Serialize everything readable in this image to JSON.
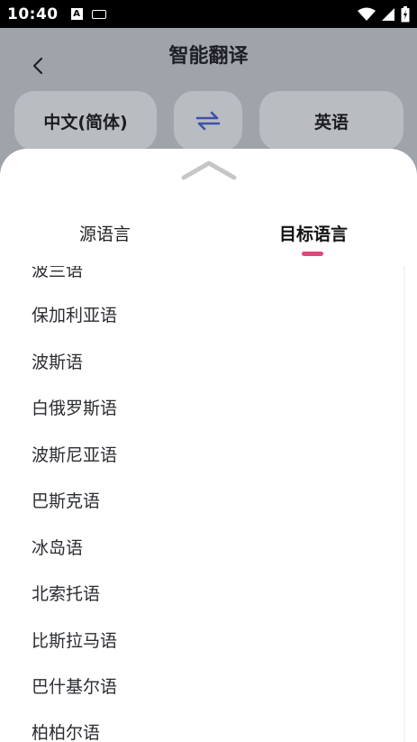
{
  "status": {
    "time": "10:40",
    "a_icon": "A"
  },
  "header": {
    "title": "智能翻译"
  },
  "languages": {
    "source": "中文(简体)",
    "target": "英语"
  },
  "sheet": {
    "tabs": [
      {
        "label": "源语言"
      },
      {
        "label": "目标语言"
      }
    ],
    "items": [
      "波兰语",
      "保加利亚语",
      "波斯语",
      "白俄罗斯语",
      "波斯尼亚语",
      "巴斯克语",
      "冰岛语",
      "北索托语",
      "比斯拉马语",
      "巴什基尔语",
      "柏柏尔语"
    ]
  },
  "colors": {
    "accent": "#e0487a",
    "swap_icon": "#3d52a8"
  }
}
